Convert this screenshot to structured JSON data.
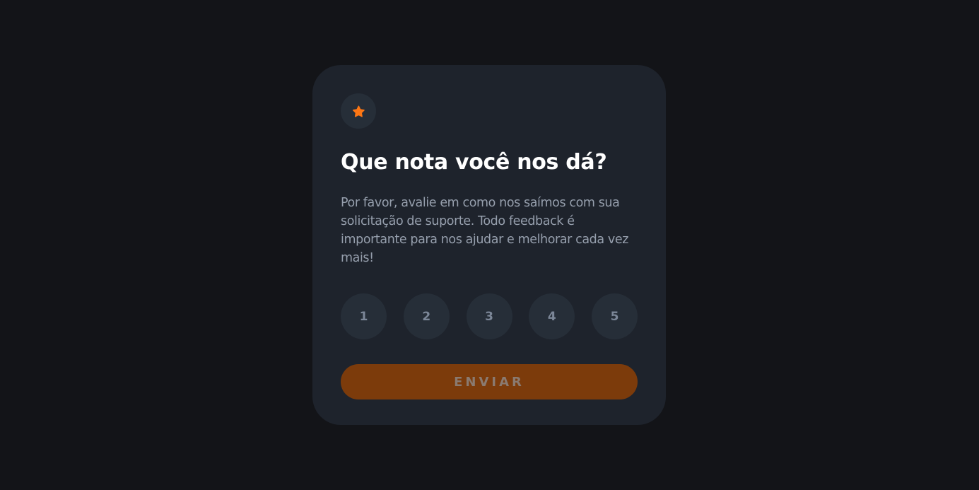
{
  "card": {
    "icon": "star-icon",
    "title": "Que nota você nos dá?",
    "description": "Por favor, avalie em como nos saímos com sua solicitação de suporte. Todo feedback é importante para nos ajudar e melhorar cada vez mais!",
    "ratings": [
      "1",
      "2",
      "3",
      "4",
      "5"
    ],
    "submit_label": "ENVIAR"
  },
  "colors": {
    "background": "#131418",
    "card": "#1e232c",
    "accent": "#fc7614",
    "button_disabled": "#7c3b0b",
    "rating_bg": "#262e38",
    "text_muted": "#969fad"
  }
}
